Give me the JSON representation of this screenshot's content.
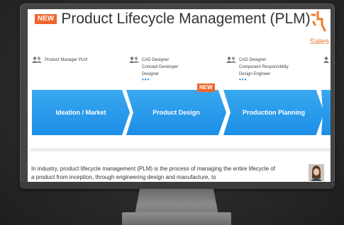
{
  "app": {
    "title": "Product Lifecycle Management (PLM)",
    "title_badge": "NEW",
    "brand_label": "Sales"
  },
  "roles": [
    {
      "lines": [
        "Product Manager PLM"
      ]
    },
    {
      "lines": [
        "CAD Designer",
        "Concept Developer",
        "Designer"
      ],
      "more": "•••"
    },
    {
      "lines": [
        "CAD Designer",
        "Component Responsibility",
        "Design Engineer"
      ],
      "more": "•••"
    }
  ],
  "stages": [
    {
      "label": "Ideation / Market"
    },
    {
      "label": "Product Design",
      "badge": "NEW"
    },
    {
      "label": "Production Planning"
    }
  ],
  "description": "In industry, product lifecycle management (PLM) is the process of managing the entire lifecycle of a product from inception, through engineering design and manufacture, to",
  "colors": {
    "accent": "#f0642a",
    "stage_blue": "#1c8ee6",
    "bezel": "#454545"
  },
  "icons": {
    "role": "person-group-icon",
    "brand": "brand-logo-icon"
  }
}
